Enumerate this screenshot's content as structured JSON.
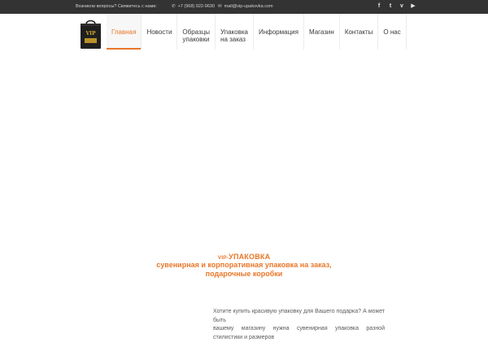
{
  "topbar": {
    "question": "Возникли вопросы? Свяжитесь с нами:",
    "phone": "+7 (968) 922-9630",
    "email": "mail@vip-upakovka.com"
  },
  "social": [
    {
      "icon": "facebook-icon",
      "glyph": "f"
    },
    {
      "icon": "twitter-icon",
      "glyph": "t"
    },
    {
      "icon": "vimeo-icon",
      "glyph": "v"
    },
    {
      "icon": "youtube-icon",
      "glyph": "▶"
    }
  ],
  "logo": {
    "text": "VIP"
  },
  "nav": [
    {
      "line1": "Главная",
      "line2": "",
      "active": true
    },
    {
      "line1": "Новости",
      "line2": "",
      "active": false
    },
    {
      "line1": "Образцы",
      "line2": "упаковки",
      "active": false
    },
    {
      "line1": "Упаковка",
      "line2": "на заказ",
      "active": false
    },
    {
      "line1": "Информация",
      "line2": "",
      "active": false
    },
    {
      "line1": "Магазин",
      "line2": "",
      "active": false
    },
    {
      "line1": "Контакты",
      "line2": "",
      "active": false
    },
    {
      "line1": "О нас",
      "line2": "",
      "active": false
    }
  ],
  "headline": {
    "prefix": "VIP-",
    "title": "УПАКОВКА",
    "line2": "сувенирная и корпоративная упаковка на заказ,",
    "line3": "подарочные коробки"
  },
  "body": {
    "line1": "Хотите купить красивую упаковку для Вашего подарка? А может быть",
    "line2": "вашему магазину нужна сувенирная упаковка разной стилистики и размеров"
  },
  "colors": {
    "accent": "#e8772a",
    "topbar_bg": "#333333",
    "text": "#3a3a3a"
  }
}
